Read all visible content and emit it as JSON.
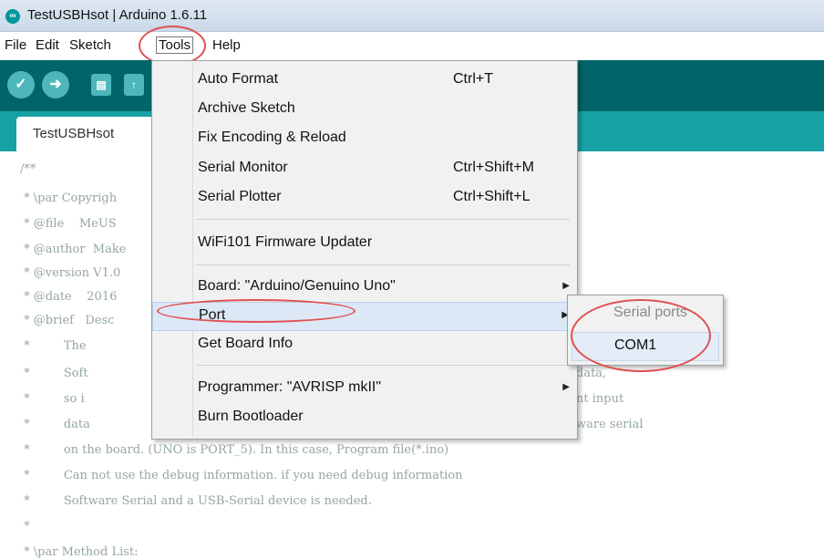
{
  "window": {
    "title": "TestUSBHsot | Arduino 1.6.11",
    "icon": "arduino-logo-icon"
  },
  "menubar": {
    "items": [
      "File",
      "Edit",
      "Sketch",
      "Tools",
      "Help"
    ]
  },
  "toolbar": {
    "icons": [
      "verify-icon",
      "upload-icon",
      "new-icon",
      "open-icon"
    ]
  },
  "tabs": [
    {
      "label": "TestUSBHsot"
    }
  ],
  "editor": {
    "lines": [
      "/**",
      " * \\par Copyrigh",
      " * @file    MeUS",
      " * @author  Make",
      " * @version V1.0",
      " * @date    2016",
      " * @brief   Desc",
      " *         The ",
      " *         Soft",
      " *         so i",
      " *         data",
      " *         on the board. (UNO is PORT_5). In this case, Program file(*.ino)",
      " *         Can not use the debug information. if you need debug information",
      " *         Software Serial and a USB-Serial device is needed.",
      " *",
      " * \\par Method List:"
    ],
    "right_fragments": [
      "data,",
      "nt input",
      "ware serial"
    ]
  },
  "tools_menu": {
    "items": [
      {
        "label": "Auto Format",
        "shortcut": "Ctrl+T"
      },
      {
        "label": "Archive Sketch",
        "shortcut": ""
      },
      {
        "label": "Fix Encoding & Reload",
        "shortcut": ""
      },
      {
        "label": "Serial Monitor",
        "shortcut": "Ctrl+Shift+M"
      },
      {
        "label": "Serial Plotter",
        "shortcut": "Ctrl+Shift+L"
      },
      {
        "label": "WiFi101 Firmware Updater",
        "shortcut": ""
      },
      {
        "label": "Board: \"Arduino/Genuino Uno\"",
        "shortcut": ""
      },
      {
        "label": "Port",
        "shortcut": ""
      },
      {
        "label": "Get Board Info",
        "shortcut": ""
      },
      {
        "label": "Programmer: \"AVRISP mkII\"",
        "shortcut": ""
      },
      {
        "label": "Burn Bootloader",
        "shortcut": ""
      }
    ],
    "highlighted": "Port"
  },
  "port_submenu": {
    "header": "Serial ports",
    "items": [
      "COM1"
    ]
  },
  "colors": {
    "toolbar": "#006468",
    "tabbar": "#17a1a5",
    "annotation": "#e05050"
  }
}
